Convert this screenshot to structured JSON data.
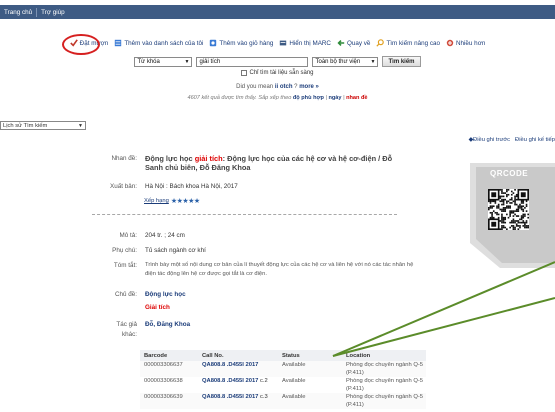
{
  "nav": {
    "items": [
      "Trang chủ",
      "Trợ giúp"
    ]
  },
  "toolbar": {
    "order": "Đặt mượn",
    "add_list": "Thêm vào danh sách của tôi",
    "add_cart": "Thêm vào giỏ hàng",
    "marc": "Hiển thị MARC",
    "back": "Quay về",
    "advanced": "Tìm kiếm nâng cao",
    "more": "Nhiều hơn"
  },
  "search": {
    "field_select": "Từ khóa",
    "query": "giải tích",
    "library_select": "Toàn bộ thư viện",
    "button": "Tìm kiếm",
    "available_only": "Chỉ tìm tài liệu sẵn sàng"
  },
  "didyoumean": {
    "prefix": "Did you mean",
    "term": "ii otch",
    "suffix": "?",
    "more": "more »"
  },
  "results": {
    "count": "4607 kết quả được tìm thấy",
    "sort_label": "Sắp xếp theo",
    "sort_relevance": "độ phù hợp",
    "sort_date": "ngày",
    "sort_title": "nhan đề"
  },
  "history": {
    "label": "Lịch sử Tìm kiếm"
  },
  "record_nav": {
    "prev": "◆Điều ghi trước",
    "next": "Điều ghi kế tiếp"
  },
  "record": {
    "title_label": "Nhan đề:",
    "title_pre": "Động lực học ",
    "title_hl": "giải tích",
    "title_post": ": Động lực học của các hệ cơ và hệ cơ-điện / Đỗ Sanh chủ biên, Đỗ Đăng Khoa",
    "pub_label": "Xuất bản:",
    "pub_value": "Hà Nội : Bách khoa Hà Nội, 2017",
    "rating_label": "Xếp hạng",
    "rating_stars": "★★★★★",
    "desc_label": "Mô tả:",
    "desc_value": "204 tr. ; 24 cm",
    "series_label": "Phụ chú:",
    "series_value": "Tủ sách ngành cơ khí",
    "summary_label": "Tóm tắt:",
    "summary_value": "Trình bày một số nội dung cơ bản của lí thuyết động lực của các hệ cơ và liên hệ với nó các tác nhân hệ điện tác động lên hệ cơ được gọi tắt là cơ điện.",
    "subject_label": "Chủ đề:",
    "subject_1": "Động lực học",
    "subject_2": "Giải tích",
    "author_label_1": "Tác giả",
    "author_label_2": "khác:",
    "author_value": "Đỗ, Đăng Khoa"
  },
  "qr": {
    "label": "QRCODE"
  },
  "holdings": {
    "headers": [
      "Barcode",
      "Call No.",
      "Status",
      "Location"
    ],
    "rows": [
      {
        "barcode": "000003306637",
        "callno": "QA808.8 .D455I 2017",
        "copy": "",
        "status": "Available",
        "location": "Phòng đọc chuyên ngành Q-5 (P.411)"
      },
      {
        "barcode": "000003306638",
        "callno": "QA808.8 .D455I 2017",
        "copy": "c.2",
        "status": "Available",
        "location": "Phòng đọc chuyên ngành Q-5 (P.411)"
      },
      {
        "barcode": "000003306639",
        "callno": "QA808.8 .D455I 2017",
        "copy": "c.3",
        "status": "Available",
        "location": "Phòng đọc chuyên ngành Q-5 (P.411)"
      }
    ]
  },
  "colors": {
    "nav_bg": "#3e5b84",
    "link": "#1c3d7a",
    "highlight": "#d00",
    "annotation_circle": "#d62020",
    "annotation_arrow": "#5b8c2a"
  }
}
